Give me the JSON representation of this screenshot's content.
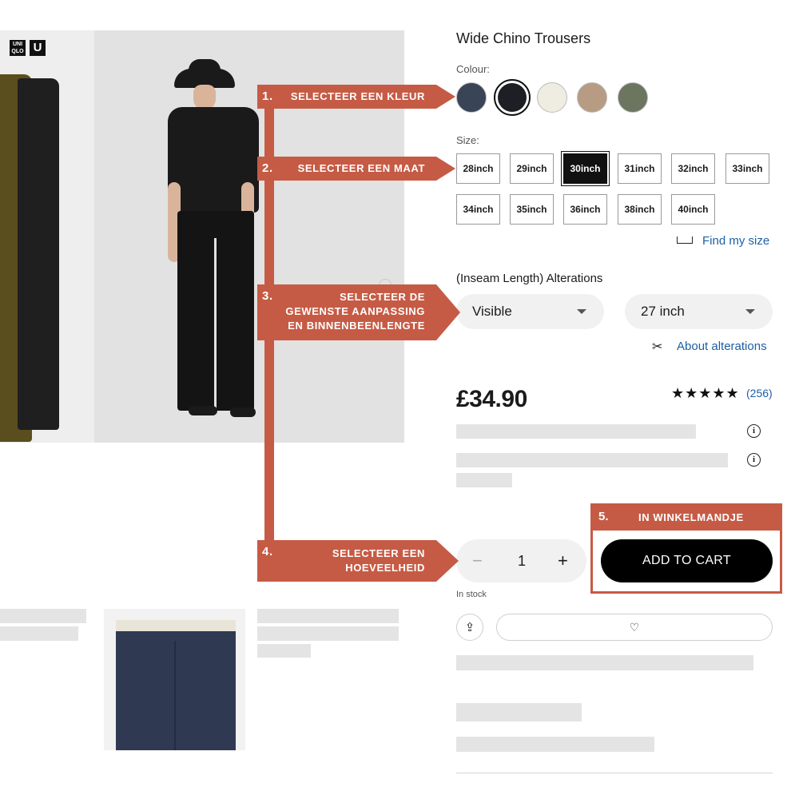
{
  "product": {
    "title": "Wide Chino Trousers",
    "colour_label": "Colour:",
    "colours": [
      {
        "name": "navy",
        "hex": "#3a4457",
        "selected": false
      },
      {
        "name": "black",
        "hex": "#1d1f24",
        "selected": true
      },
      {
        "name": "off-white",
        "hex": "#efece2",
        "selected": false
      },
      {
        "name": "beige",
        "hex": "#b79c83",
        "selected": false
      },
      {
        "name": "olive",
        "hex": "#6c7560",
        "selected": false
      }
    ],
    "size_label": "Size:",
    "sizes": [
      {
        "label": "28inch",
        "selected": false
      },
      {
        "label": "29inch",
        "selected": false
      },
      {
        "label": "30inch",
        "selected": true
      },
      {
        "label": "31inch",
        "selected": false
      },
      {
        "label": "32inch",
        "selected": false
      },
      {
        "label": "33inch",
        "selected": false
      },
      {
        "label": "34inch",
        "selected": false
      },
      {
        "label": "35inch",
        "selected": false
      },
      {
        "label": "36inch",
        "selected": false
      },
      {
        "label": "38inch",
        "selected": false
      },
      {
        "label": "40inch",
        "selected": false
      }
    ],
    "find_my_size": "Find my size",
    "alterations_label": "(Inseam Length) Alterations",
    "alteration_type": "Visible",
    "inseam_length": "27 inch",
    "about_alterations": "About alterations",
    "price": "£34.90",
    "rating_stars": "★★★★★",
    "rating_value": 4.5,
    "reviews": "(256)",
    "quantity": "1",
    "qty_minus": "−",
    "qty_plus": "+",
    "add_to_cart": "ADD TO CART",
    "stock_status": "In stock",
    "share_icon": "share-icon",
    "favorite_icon": "heart-icon"
  },
  "brand": {
    "logo_uq": "UNI QLO",
    "logo_u": "U"
  },
  "annotations": {
    "step1": {
      "num": "1.",
      "text": "SELECTEER EEN KLEUR"
    },
    "step2": {
      "num": "2.",
      "text": "SELECTEER EEN MAAT"
    },
    "step3": {
      "num": "3.",
      "text": "SELECTEER DE\nGEWENSTE AANPASSING\nEN BINNENBEENLENGTE"
    },
    "step4": {
      "num": "4.",
      "text": "SELECTEER EEN\nHOEVEELHEID"
    },
    "step5": {
      "num": "5.",
      "text": "IN WINKELMANDJE"
    },
    "color": "#c65b45"
  },
  "colors": {
    "accent_link": "#1c5fa8",
    "cart_button": "#000000",
    "placeholder_bar": "#e4e4e4"
  }
}
